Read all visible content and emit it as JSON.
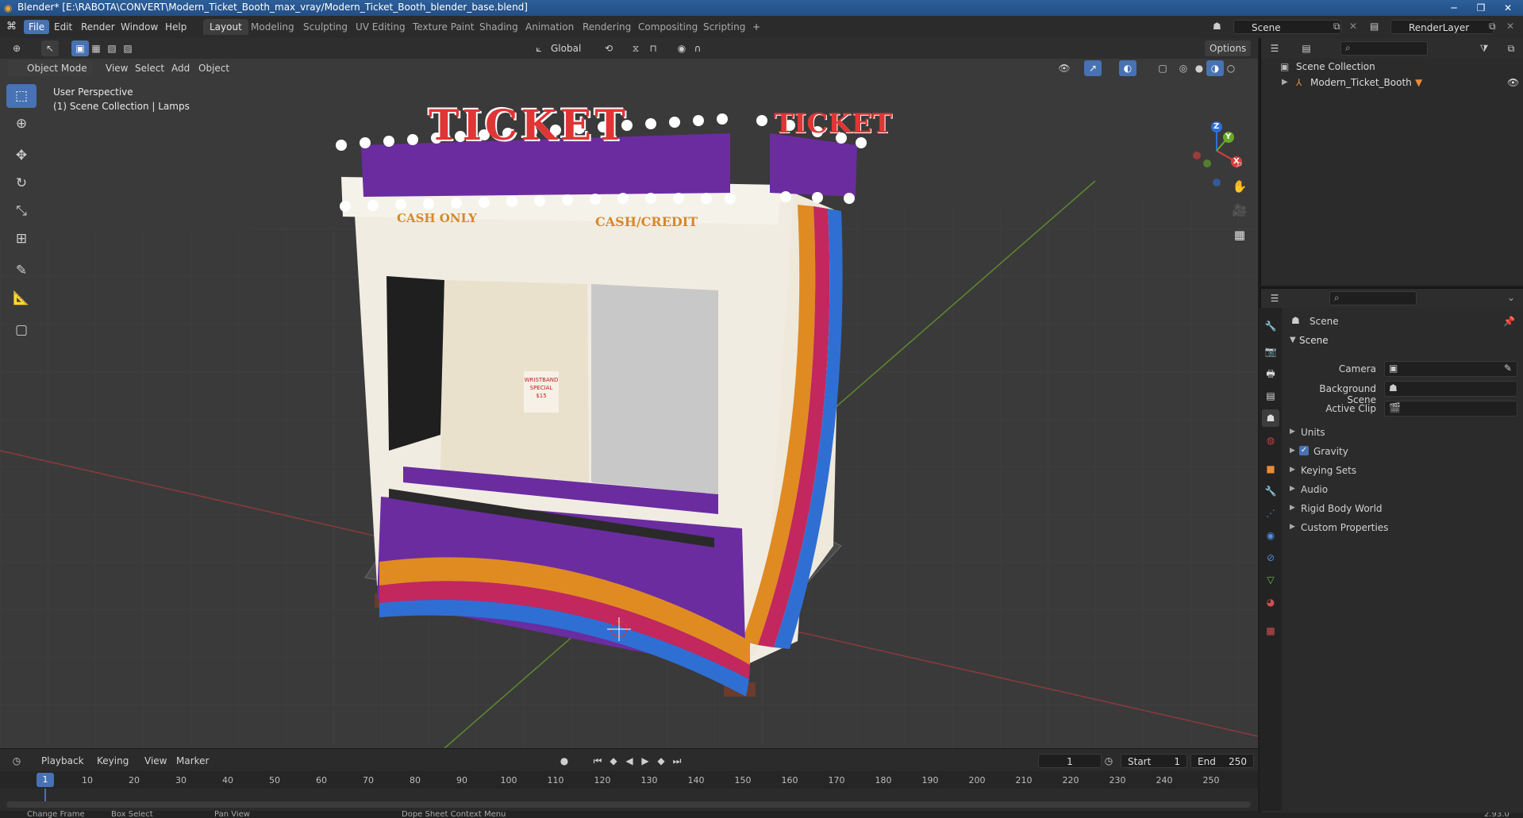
{
  "window": {
    "title": "Blender* [E:\\RABOTA\\CONVERT\\Modern_Ticket_Booth_max_vray/Modern_Ticket_Booth_blender_base.blend]"
  },
  "menu": {
    "items": [
      "File",
      "Edit",
      "Render",
      "Window",
      "Help"
    ],
    "workspaces": [
      "Layout",
      "Modeling",
      "Sculpting",
      "UV Editing",
      "Texture Paint",
      "Shading",
      "Animation",
      "Rendering",
      "Compositing",
      "Scripting"
    ],
    "add_workspace": "+",
    "scene_name": "Scene",
    "render_layer": "RenderLayer"
  },
  "viewport": {
    "transform_orientation": "Global",
    "options_label": "Options",
    "mode": "Object Mode",
    "header_menus": [
      "View",
      "Select",
      "Add",
      "Object"
    ],
    "overlay_line1": "User Perspective",
    "overlay_line2": "(1) Scene Collection | Lamps",
    "gizmo": {
      "z": "Z",
      "y": "Y",
      "x": "X"
    },
    "booth_text": {
      "front_sign": "TICKET",
      "side_sign": "TICKET",
      "left_window": "CASH ONLY",
      "right_window": "CASH/CREDIT",
      "poster": "WRISTBAND SPECIAL $15"
    }
  },
  "timeline": {
    "menus": [
      "Playback",
      "Keying",
      "View",
      "Marker"
    ],
    "current_frame": "1",
    "start_label": "Start",
    "start_value": "1",
    "end_label": "End",
    "end_value": "250",
    "ruler": [
      "10",
      "20",
      "30",
      "40",
      "50",
      "60",
      "70",
      "80",
      "90",
      "100",
      "110",
      "120",
      "130",
      "140",
      "150",
      "160",
      "170",
      "180",
      "190",
      "200",
      "210",
      "220",
      "230",
      "240",
      "250"
    ],
    "playhead": "1"
  },
  "statusbar": {
    "items": [
      "Change Frame",
      "Box Select",
      "Pan View",
      "Dope Sheet Context Menu"
    ],
    "version": "2.93.0"
  },
  "outliner": {
    "root": "Scene Collection",
    "child": "Modern_Ticket_Booth"
  },
  "properties": {
    "header": "Scene",
    "panel": "Scene",
    "camera_label": "Camera",
    "background_scene_label": "Background Scene",
    "active_clip_label": "Active Clip",
    "sections": [
      "Units",
      "Gravity",
      "Keying Sets",
      "Audio",
      "Rigid Body World",
      "Custom Properties"
    ],
    "gravity_checked": true
  }
}
